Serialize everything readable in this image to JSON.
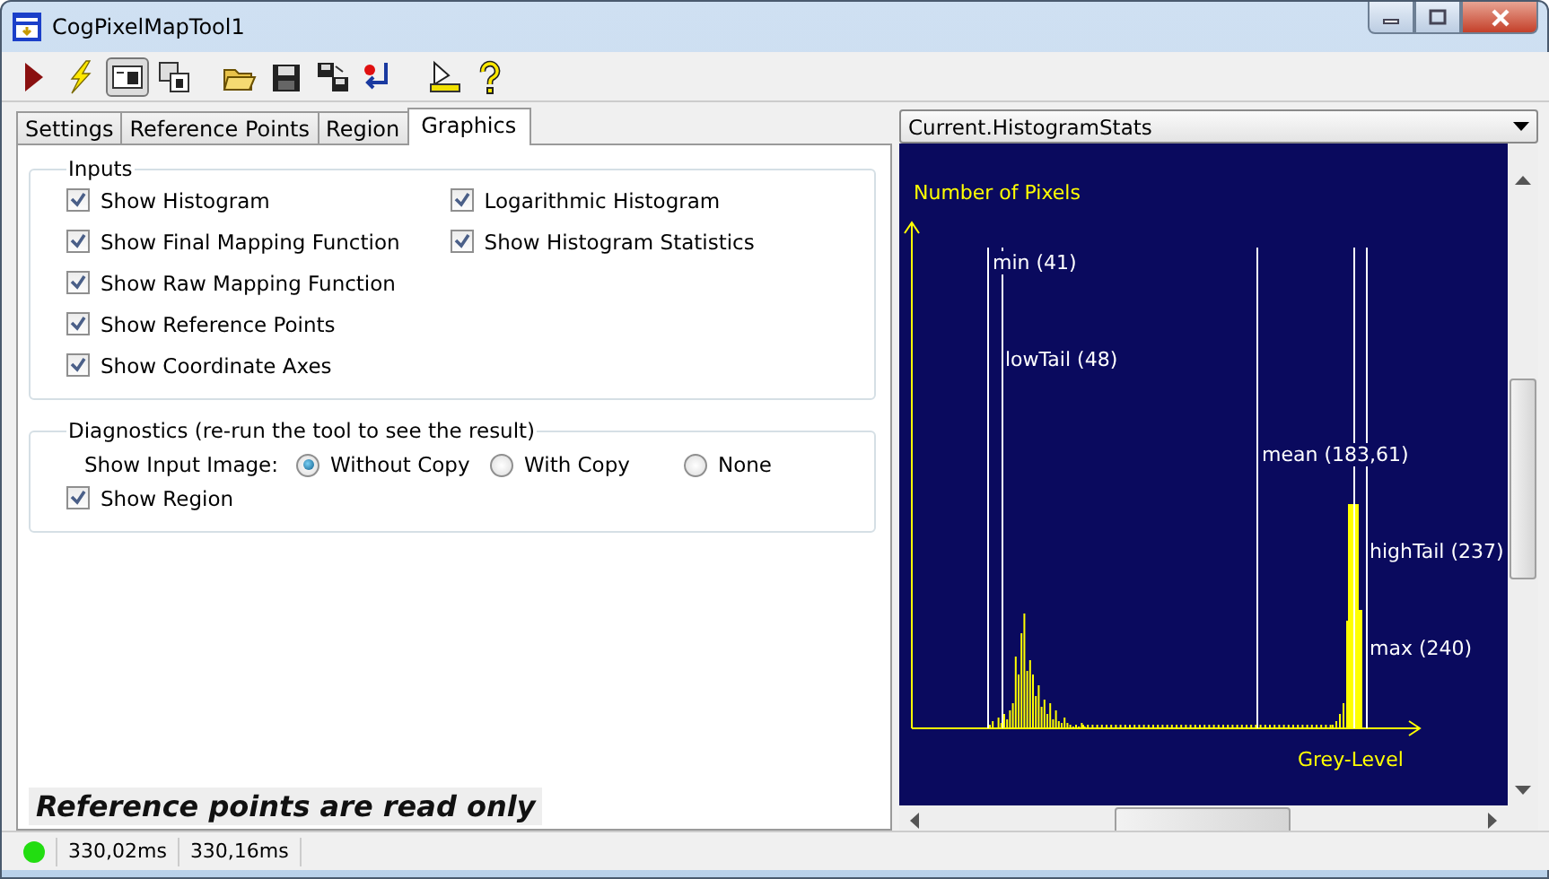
{
  "window": {
    "title": "CogPixelMapTool1"
  },
  "toolbar": [
    {
      "kind": "run",
      "pressed": false
    },
    {
      "kind": "lightning",
      "pressed": false
    },
    {
      "kind": "image-view",
      "pressed": true
    },
    {
      "kind": "image-copy",
      "pressed": false
    },
    {
      "kind": "open",
      "pressed": false
    },
    {
      "kind": "save",
      "pressed": false
    },
    {
      "kind": "save-copy",
      "pressed": false
    },
    {
      "kind": "reset",
      "pressed": false
    },
    {
      "kind": "measure",
      "pressed": false
    },
    {
      "kind": "help",
      "pressed": false
    }
  ],
  "tabs": [
    {
      "label": "Settings",
      "selected": false
    },
    {
      "label": "Reference Points",
      "selected": false
    },
    {
      "label": "Region",
      "selected": false
    },
    {
      "label": "Graphics",
      "selected": true
    }
  ],
  "inputs": {
    "title": "Inputs",
    "columns": [
      [
        {
          "label": "Show Histogram",
          "checked": true
        },
        {
          "label": "Show Final Mapping Function",
          "checked": true
        },
        {
          "label": "Show Raw Mapping Function",
          "checked": true
        },
        {
          "label": "Show Reference Points",
          "checked": true
        },
        {
          "label": "Show Coordinate Axes",
          "checked": true
        }
      ],
      [
        {
          "label": "Logarithmic Histogram",
          "checked": true
        },
        {
          "label": "Show Histogram Statistics",
          "checked": true
        }
      ]
    ]
  },
  "diagnostics": {
    "title": "Diagnostics (re-run the tool to see the result)",
    "input_image": {
      "label": "Show Input Image:",
      "options": [
        {
          "label": "Without Copy",
          "selected": true
        },
        {
          "label": "With Copy",
          "selected": false
        },
        {
          "label": "None",
          "selected": false
        }
      ]
    },
    "checkboxes": [
      {
        "label": "Show Region",
        "checked": true
      }
    ]
  },
  "note": "Reference points are read only",
  "view": {
    "selector": "Current.HistogramStats",
    "y_axis_label": "Number of Pixels",
    "x_axis_label": "Grey-Level",
    "markers": [
      {
        "label": "min (41)"
      },
      {
        "label": "lowTail (48)"
      },
      {
        "label": "mean (183,61)"
      },
      {
        "label": "highTail (237)"
      },
      {
        "label": "max (240)"
      }
    ]
  },
  "status_bar": {
    "indicator": {
      "color": "#22dd11"
    },
    "times": [
      "330,02ms",
      "330,16ms"
    ]
  }
}
